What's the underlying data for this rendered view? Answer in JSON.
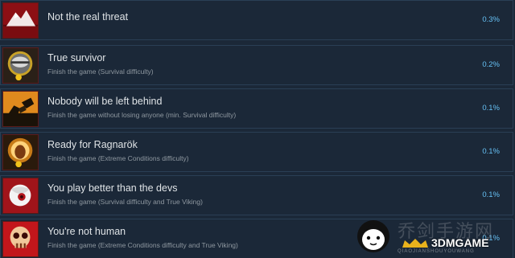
{
  "achievements": [
    {
      "name": "Not the real threat",
      "description": "",
      "percent": "0.3%",
      "icon": "mountain-icon"
    },
    {
      "name": "True survivor",
      "description": "Finish the game (Survival difficulty)",
      "percent": "0.2%",
      "icon": "helmet-icon"
    },
    {
      "name": "Nobody will be left behind",
      "description": "Finish the game without losing anyone (min. Survival difficulty)",
      "percent": "0.1%",
      "icon": "hands-icon"
    },
    {
      "name": "Ready for Ragnarök",
      "description": "Finish the game (Extreme Conditions difficulty)",
      "percent": "0.1%",
      "icon": "viking-icon"
    },
    {
      "name": "You play better than the devs",
      "description": "Finish the game (Survival difficulty and True Viking)",
      "percent": "0.1%",
      "icon": "eye-icon"
    },
    {
      "name": "You're not human",
      "description": "Finish the game (Extreme Conditions difficulty and True Viking)",
      "percent": "0.1%",
      "icon": "skull-icon"
    }
  ],
  "watermark": {
    "chinese_text": "乔剑手游网",
    "brand": "3DMGAME",
    "subtext": "QIAOJIANSHOUYOUWANG"
  },
  "colors": {
    "background": "#1b2838",
    "row_border": "#2a3f55",
    "name_text": "#dfe3e6",
    "description_text": "#8f98a0",
    "percent_text": "#66c0f4"
  }
}
